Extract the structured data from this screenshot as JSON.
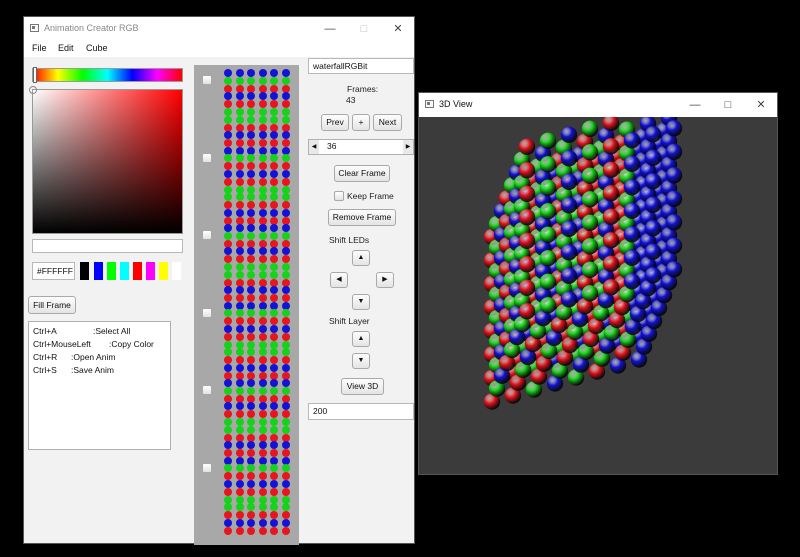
{
  "main_window": {
    "title": "Animation Creator RGB",
    "controls": {
      "minimize": "—",
      "maximize": "□",
      "close": "✕"
    },
    "menu": [
      "File",
      "Edit",
      "Cube"
    ]
  },
  "color_picker": {
    "hex_value": "#FFFFFF",
    "swatches": [
      "#000000",
      "#0000ff",
      "#00ff00",
      "#00ffff",
      "#ff0000",
      "#ff00ff",
      "#ffff00",
      "#ffffff"
    ]
  },
  "fill_frame_label": "Fill Frame",
  "shortcuts": [
    {
      "key": "Ctrl+A",
      "action": ":Select All"
    },
    {
      "key": "Ctrl+MouseLeft",
      "action": ":Copy Color"
    },
    {
      "key": "Ctrl+R",
      "action": ":Open Anim"
    },
    {
      "key": "Ctrl+S",
      "action": ":Save Anim"
    }
  ],
  "frames": {
    "count": 6,
    "row_colors": [
      "blue",
      "green",
      "red",
      "blue",
      "red",
      "green",
      "green",
      "red",
      "blue",
      "red"
    ]
  },
  "controls": {
    "anim_name": "waterfallRGBit",
    "frames_label": "Frames:",
    "frames_count": "43",
    "prev_label": "Prev",
    "plus_label": "+",
    "next_label": "Next",
    "frame_index": "36",
    "clear_frame_label": "Clear Frame",
    "keep_frame_label": "Keep Frame",
    "remove_frame_label": "Remove Frame",
    "shift_leds_label": "Shift LEDs",
    "shift_layer_label": "Shift Layer",
    "view3d_label": "View 3D",
    "delay_value": "200",
    "arrow_up": "▲",
    "arrow_down": "▼",
    "arrow_left": "◀",
    "arrow_right": "▶"
  },
  "view3d_window": {
    "title": "3D View",
    "controls": {
      "minimize": "—",
      "maximize": "□",
      "close": "✕"
    }
  },
  "colors": {
    "red": "#e8141e",
    "green": "#17d21a",
    "blue": "#1313d8",
    "viewport_bg": "#3b3b3b",
    "frames_panel_bg": "#a8a8a8"
  }
}
